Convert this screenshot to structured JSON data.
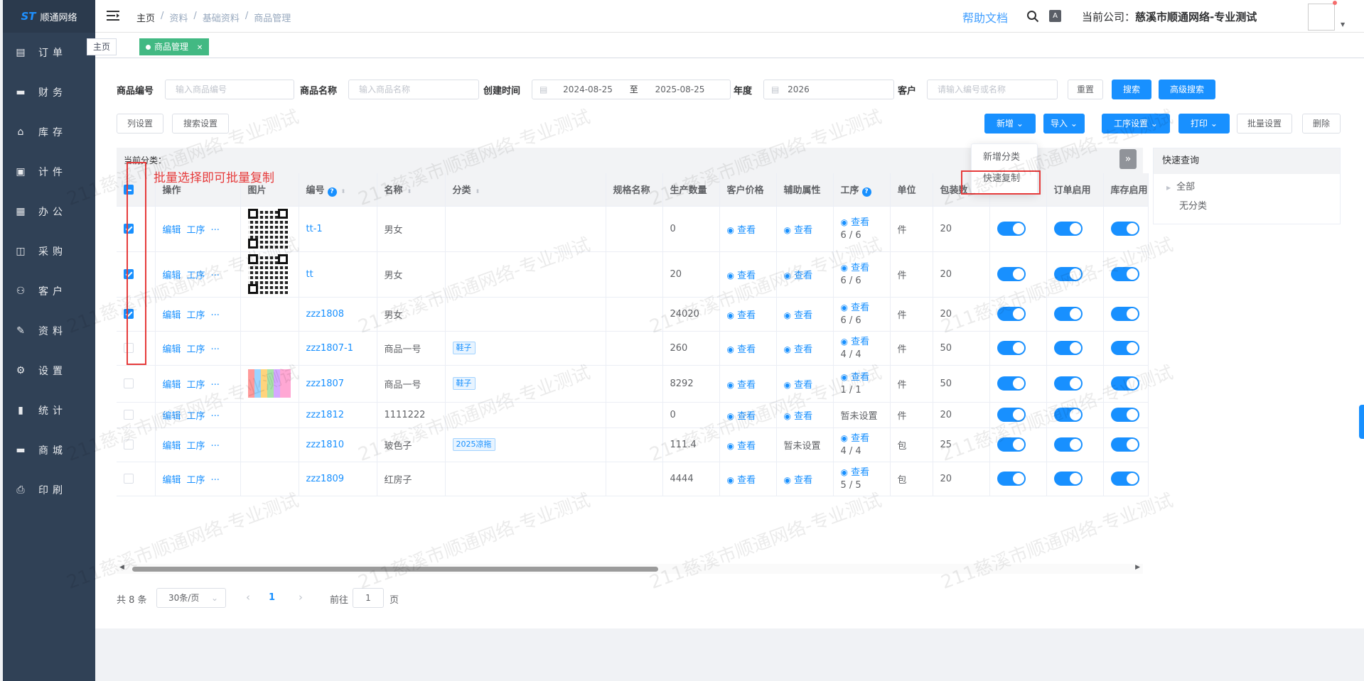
{
  "app": {
    "logo_text": "顺通网络",
    "logo_mark": "ST"
  },
  "sidebar": {
    "items": [
      {
        "label": "订单",
        "icon": "document-icon"
      },
      {
        "label": "财务",
        "icon": "lock-icon"
      },
      {
        "label": "库存",
        "icon": "home-icon"
      },
      {
        "label": "计件",
        "icon": "clipboard-icon"
      },
      {
        "label": "办公",
        "icon": "calendar-icon"
      },
      {
        "label": "采购",
        "icon": "shopping-bag-icon"
      },
      {
        "label": "客户",
        "icon": "user-icon"
      },
      {
        "label": "资料",
        "icon": "edit-icon"
      },
      {
        "label": "设置",
        "icon": "gear-icon"
      },
      {
        "label": "统计",
        "icon": "bar-chart-icon"
      },
      {
        "label": "商城",
        "icon": "store-icon"
      },
      {
        "label": "印刷",
        "icon": "printer-icon"
      }
    ]
  },
  "navbar": {
    "breadcrumb": [
      "主页",
      "资料",
      "基础资料",
      "商品管理"
    ],
    "help": "帮助文档",
    "company_label": "当前公司：",
    "company_name": "慈溪市顺通网络-专业测试"
  },
  "tags": {
    "home": "主页",
    "active": "商品管理"
  },
  "filters": {
    "code_label": "商品编号",
    "code_placeholder": "输入商品编号",
    "name_label": "商品名称",
    "name_placeholder": "输入商品名称",
    "created_label": "创建时间",
    "date_from": "2024-08-25",
    "date_sep": "至",
    "date_to": "2025-08-25",
    "year_label": "年度",
    "year_value": "2026",
    "customer_label": "客户",
    "customer_placeholder": "请输入编号或名称",
    "reset": "重置",
    "search": "搜索",
    "advanced": "高级搜索"
  },
  "toolbar": {
    "col_settings": "列设置",
    "search_settings": "搜索设置",
    "add": "新增",
    "import": "导入",
    "process_settings": "工序设置",
    "print": "打印",
    "batch_settings": "批量设置",
    "delete": "删除"
  },
  "dropdown": {
    "items": [
      "新增分类",
      "快速复制"
    ]
  },
  "category_bar": "当前分类：",
  "annotation": "批量选择即可批量复制",
  "table": {
    "headers": [
      "操作",
      "图片",
      "编号",
      "名称",
      "分类",
      "规格名称",
      "生产数量",
      "客户价格",
      "辅助属性",
      "工序",
      "单位",
      "包装数",
      "",
      "订单启用",
      "库存启用"
    ],
    "op_edit": "编辑",
    "op_process": "工序",
    "op_more": "···",
    "view": "查看",
    "rows": [
      {
        "checked": true,
        "img": "qr",
        "code": "tt-1",
        "name": "男女",
        "category": "",
        "qty": "0",
        "aux": "查看",
        "process": "6 / 6",
        "unit": "件",
        "pack": "20"
      },
      {
        "checked": true,
        "img": "qr",
        "code": "tt",
        "name": "男女",
        "category": "",
        "qty": "20",
        "aux": "查看",
        "process": "6 / 6",
        "unit": "件",
        "pack": "20"
      },
      {
        "checked": true,
        "img": "",
        "code": "zzz1808",
        "name": "男女",
        "category": "",
        "qty": "24020",
        "aux": "查看",
        "process": "6 / 6",
        "unit": "件",
        "pack": "20"
      },
      {
        "checked": false,
        "img": "",
        "code": "zzz1807-1",
        "name": "商品一号",
        "category": "鞋子",
        "qty": "260",
        "aux": "查看",
        "process": "4 / 4",
        "unit": "件",
        "pack": "50"
      },
      {
        "checked": false,
        "img": "photo",
        "code": "zzz1807",
        "name": "商品一号",
        "category": "鞋子",
        "qty": "8292",
        "aux": "查看",
        "process": "1 / 1",
        "unit": "件",
        "pack": "50"
      },
      {
        "checked": false,
        "img": "",
        "code": "zzz1812",
        "name": "1111222",
        "category": "",
        "qty": "0",
        "aux": "查看",
        "process": "暂未设置",
        "unit": "件",
        "pack": "20"
      },
      {
        "checked": false,
        "img": "",
        "code": "zzz1810",
        "name": "玻色子",
        "category": "2025凉拖",
        "qty": "111.4",
        "aux": "暂未设置",
        "process": "4 / 4",
        "unit": "包",
        "pack": "25"
      },
      {
        "checked": false,
        "img": "",
        "code": "zzz1809",
        "name": "红房子",
        "category": "",
        "qty": "4444",
        "aux": "查看",
        "process": "5 / 5",
        "unit": "包",
        "pack": "20"
      }
    ]
  },
  "quick_panel": {
    "title": "快速查询",
    "items": [
      "全部",
      "无分类"
    ]
  },
  "pager": {
    "total": "共 8 条",
    "page_size": "30条/页",
    "current": "1",
    "goto_label": "前往",
    "goto_value": "1",
    "page_unit": "页"
  },
  "watermark": "211慈溪市顺通网络-专业测试"
}
